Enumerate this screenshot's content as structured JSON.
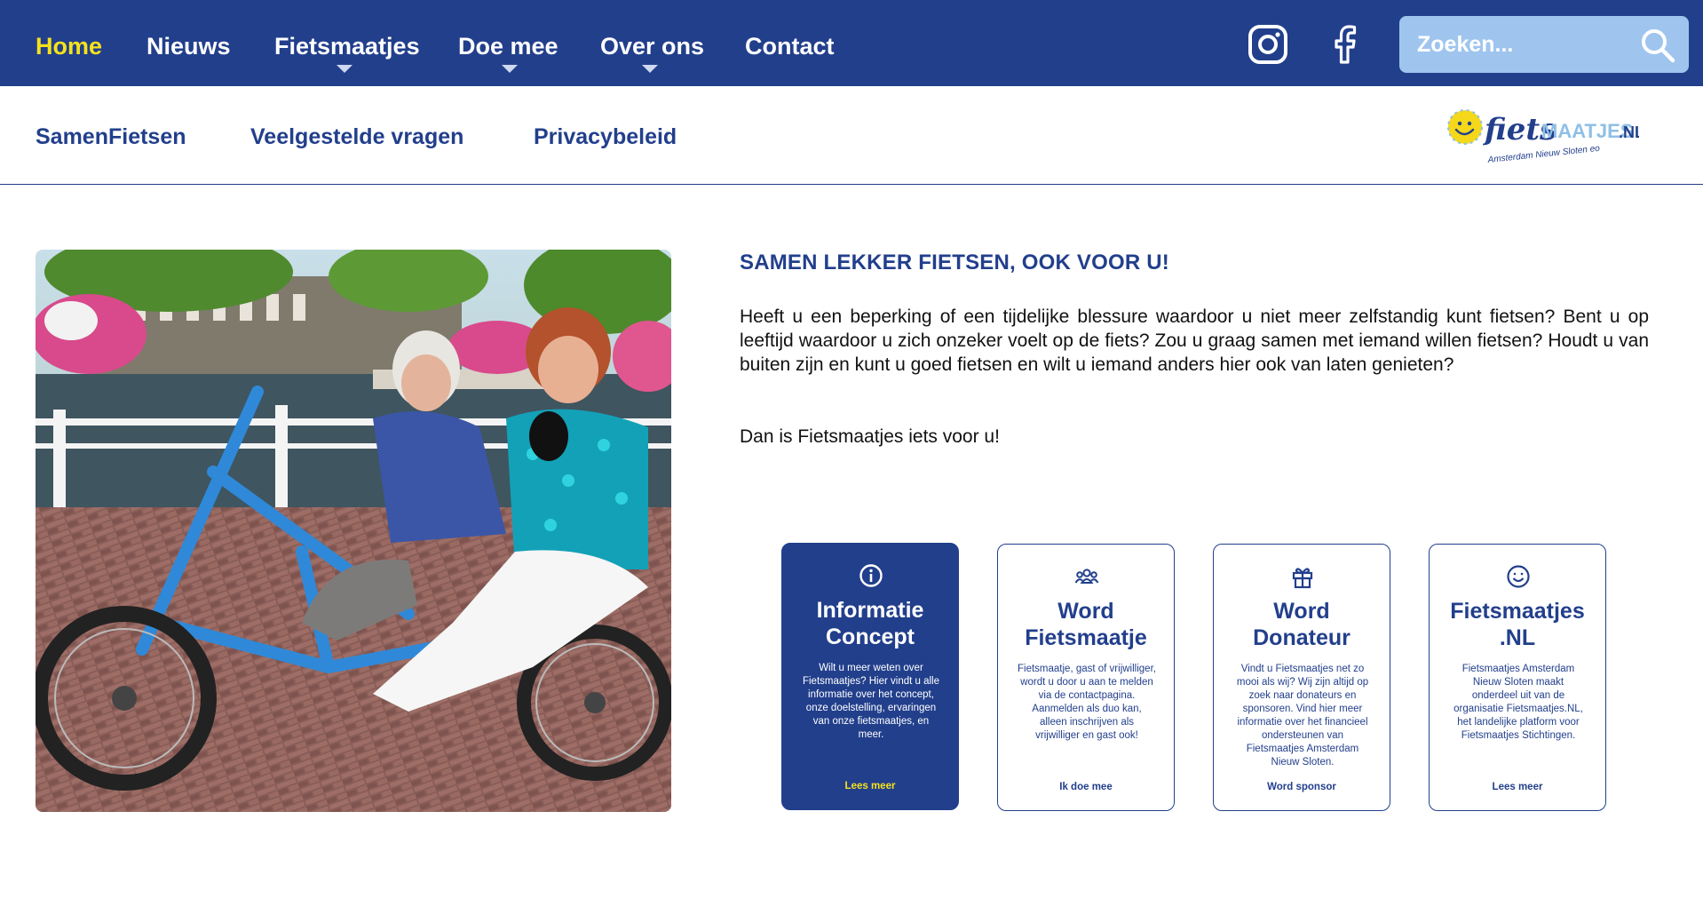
{
  "topnav": {
    "items": [
      {
        "label": "Home",
        "active": true
      },
      {
        "label": "Nieuws"
      },
      {
        "label": "Fietsmaatjes",
        "has_dropdown": true
      },
      {
        "label": "Doe mee",
        "has_dropdown": true
      },
      {
        "label": "Over ons",
        "has_dropdown": true
      },
      {
        "label": "Contact"
      }
    ],
    "social": [
      "instagram-icon",
      "facebook-icon"
    ],
    "search": {
      "placeholder": "Zoeken...",
      "icon": "search-icon"
    }
  },
  "subnav": {
    "items": [
      {
        "label": "SamenFietsen"
      },
      {
        "label": "Veelgestelde vragen"
      },
      {
        "label": "Privacybeleid"
      }
    ],
    "logo": {
      "brand_text": "fietsMAATJES.NL",
      "subtext": "Amsterdam Nieuw Sloten eo"
    }
  },
  "main": {
    "headline": "SAMEN LEKKER FIETSEN, OOK VOOR U!",
    "paragraph": "Heeft u een beperking of een tijdelijke blessure waardoor u niet meer zelfstandig kunt fietsen? Bent u op leeftijd waardoor u zich onzeker voelt op de fiets? Zou u graag samen met iemand willen fietsen?  Houdt u van buiten zijn en kunt u goed fietsen en wilt u iemand anders hier ook van laten genieten?",
    "paragraph2": "Dan is Fietsmaatjes iets voor u!"
  },
  "cards": [
    {
      "icon": "info-icon",
      "title_line1": "Informatie",
      "title_line2": "Concept",
      "description": "Wilt u meer weten over Fietsmaatjes? Hier vindt u alle informatie over het concept, onze doelstelling, ervaringen van onze fietsmaatjes, en meer.",
      "link": "Lees meer"
    },
    {
      "icon": "people-group-icon",
      "title_line1": "Word",
      "title_line2": "Fietsmaatje",
      "description": "Fietsmaatje, gast of vrijwilliger, wordt u door u aan te melden via de contactpagina. Aanmelden als duo kan, alleen inschrijven als vrijwilliger en gast ook!",
      "link": "Ik doe mee"
    },
    {
      "icon": "gift-icon",
      "title_line1": "Word",
      "title_line2": "Donateur",
      "description": "Vindt u Fietsmaatjes net zo mooi als wij? Wij zijn altijd op zoek naar donateurs en sponsoren. Vind hier meer informatie over het financieel ondersteunen van Fietsmaatjes Amsterdam Nieuw Sloten.",
      "link": "Word sponsor"
    },
    {
      "icon": "smiley-icon",
      "title_line1": "Fietsmaatjes",
      "title_line2": ".NL",
      "description": "Fietsmaatjes Amsterdam Nieuw Sloten maakt onderdeel uit van de organisatie Fietsmaatjes.NL, het landelijke platform voor Fietsmaatjes Stichtingen.",
      "link": "Lees meer"
    }
  ],
  "colors": {
    "primary": "#223f8c",
    "accent": "#f5e21c",
    "search_bg": "#9fc5ee"
  }
}
